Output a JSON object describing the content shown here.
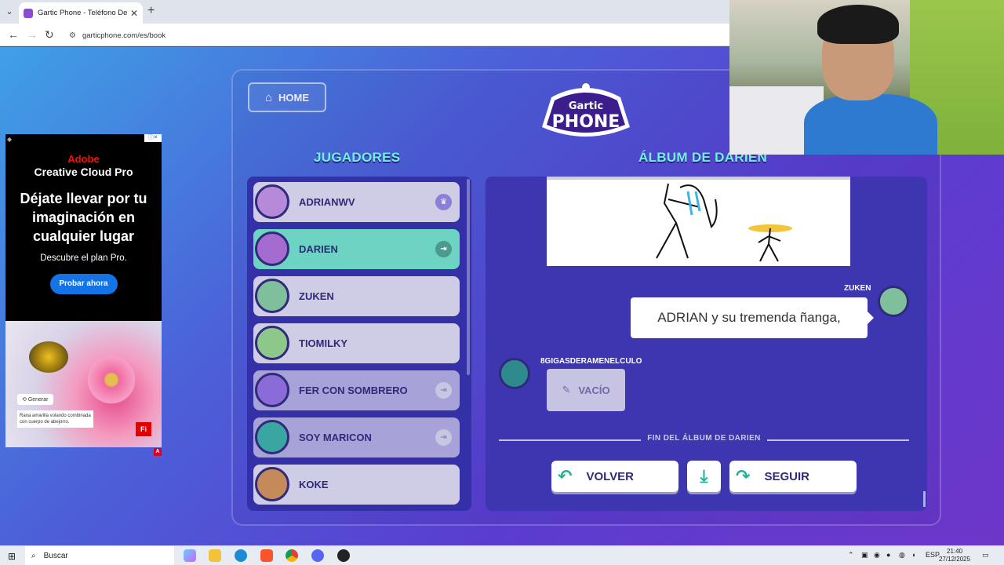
{
  "browser": {
    "tab_title": "Gartic Phone - Teléfono Descon",
    "url": "garticphone.com/es/book"
  },
  "ad": {
    "brand": "Adobe",
    "product": "Creative Cloud Pro",
    "headline": "Déjate llevar por tu imaginación en cualquier lugar",
    "subline": "Descubre el plan Pro.",
    "cta": "Probar ahora",
    "generate_label": "Generar",
    "image_caption": "Rana amarilla volando combinada con cuerpo de abejorro.",
    "badge": "Fi"
  },
  "game": {
    "home_label": "HOME",
    "logo_top": "Gartic",
    "logo_main": "PHONE",
    "players_title": "JUGADORES",
    "album_title": "ÁLBUM DE DARIEN",
    "players": [
      {
        "name": "ADRIANWV",
        "state": "normal",
        "badge": "crown-icon"
      },
      {
        "name": "DARIEN",
        "state": "active",
        "badge": "exit-icon"
      },
      {
        "name": "ZUKEN",
        "state": "normal",
        "badge": ""
      },
      {
        "name": "TIOMILKY",
        "state": "normal",
        "badge": ""
      },
      {
        "name": "FER CON SOMBRERO",
        "state": "dim",
        "badge": "exit-icon"
      },
      {
        "name": "SOY MARICON",
        "state": "dim",
        "badge": "exit-icon"
      },
      {
        "name": "KOKE",
        "state": "normal",
        "badge": ""
      }
    ],
    "album": {
      "msg1_author": "ZUKEN",
      "msg1_text": "ADRIAN y su tremenda ñanga,",
      "msg2_author": "8GIGASDERAMENELCULO",
      "msg2_text": "VACÍO",
      "end_text": "FIN DEL ÁLBUM DE DARIEN",
      "back_label": "VOLVER",
      "next_label": "SEGUIR"
    }
  },
  "taskbar": {
    "search_label": "Buscar",
    "lang": "ESP",
    "time": "21:40",
    "date": "27/12/2025"
  },
  "colors": {
    "accent_teal": "#6dd3c3",
    "title_cyan": "#6ff0e0",
    "panel_purple": "#3d36b0"
  }
}
